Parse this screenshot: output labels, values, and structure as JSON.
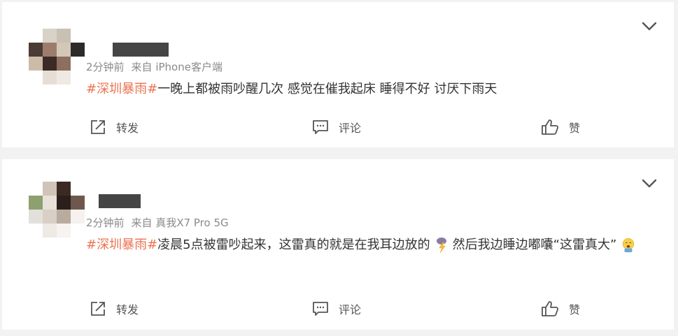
{
  "posts": [
    {
      "time": "2分钟前",
      "source": "来自 iPhone客户端",
      "hashtag": "#深圳暴雨#",
      "content": "一晚上都被雨吵醒几次 感觉在催我起床 睡得不好 讨厌下雨天",
      "actions": {
        "repost": "转发",
        "comment": "评论",
        "like": "赞"
      }
    },
    {
      "time": "2分钟前",
      "source": "来自 真我X7 Pro 5G",
      "hashtag": "#深圳暴雨#",
      "content_part1": "凌晨5点被雷吵起来，这雷真的就是在我耳边放的",
      "content_part2": "然后我边睡边嘟囔“这雷真大”",
      "actions": {
        "repost": "转发",
        "comment": "评论",
        "like": "赞"
      }
    }
  ],
  "colors": {
    "hashtag": "#eb7350",
    "meta": "#8a8a8a",
    "background": "#f2f2f2"
  },
  "icons": [
    "chevron-down-icon",
    "repost-icon",
    "comment-icon",
    "like-icon",
    "lightning-emoji-icon",
    "yawn-emoji-icon"
  ]
}
